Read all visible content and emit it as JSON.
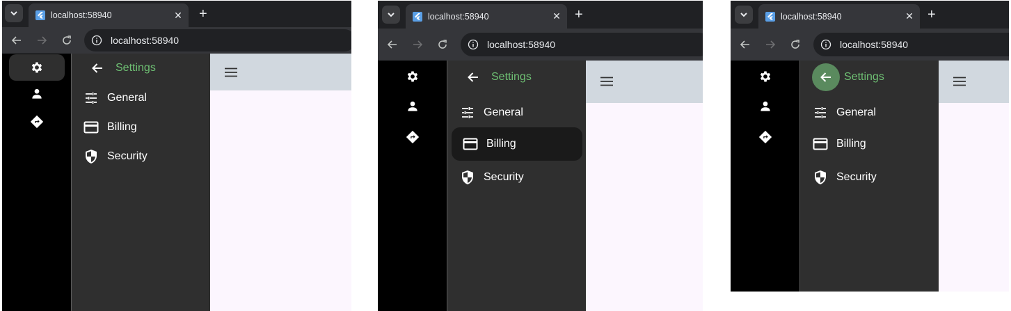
{
  "browser": {
    "tab_title": "localhost:58940",
    "url": "localhost:58940",
    "new_tab_label": "+",
    "close_tab_label": "✕"
  },
  "drawer": {
    "title": "Settings",
    "items": [
      {
        "label": "General",
        "icon": "tune-icon"
      },
      {
        "label": "Billing",
        "icon": "credit-card-icon"
      },
      {
        "label": "Security",
        "icon": "shield-icon"
      }
    ]
  },
  "rail": {
    "items": [
      {
        "icon": "gear-icon"
      },
      {
        "icon": "person-icon"
      },
      {
        "icon": "directions-icon"
      }
    ]
  },
  "colors": {
    "accent_title": "#6ebf73",
    "back_hover": "#5a8a5e",
    "appbar": "#d1d8df",
    "drawer_bg": "#2f2f2f",
    "rail_bg": "#000000",
    "content_bg": "#fcf6fe"
  },
  "panels": [
    {
      "state": "default",
      "selected_rail": "gear-icon",
      "selected_item": null,
      "back_hover": false
    },
    {
      "state": "billing-selected",
      "selected_rail": null,
      "selected_item": "Billing",
      "back_hover": false
    },
    {
      "state": "back-hover",
      "selected_rail": null,
      "selected_item": null,
      "back_hover": true
    }
  ]
}
